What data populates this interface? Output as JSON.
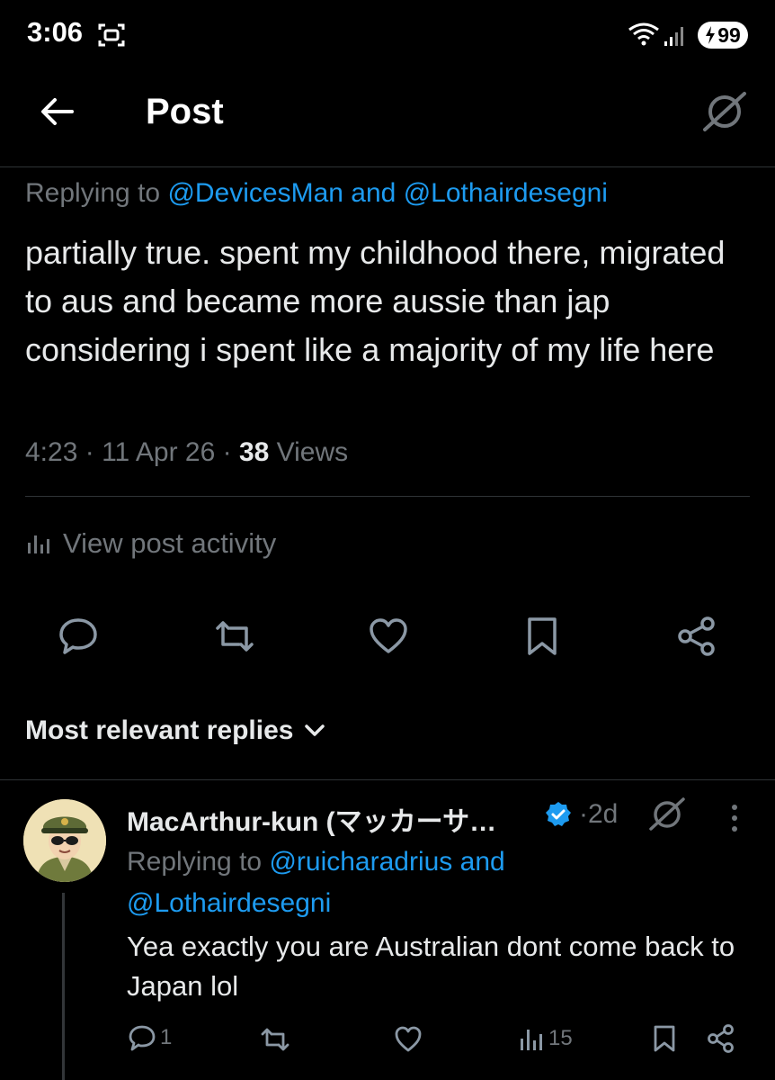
{
  "status_bar": {
    "time": "3:06",
    "battery": "99"
  },
  "header": {
    "title": "Post"
  },
  "post": {
    "replying_prefix": "Replying to",
    "replying_user1": "@DevicesMan",
    "replying_and": "and",
    "replying_user2": "@Lothairdesegni",
    "text": "partially true. spent my childhood there, migrated to aus and became more aussie than jap considering i spent like a majority of my life here",
    "time": "4:23",
    "date": "11 Apr 26",
    "views_count": "38",
    "views_label": "Views",
    "activity_label": "View post activity"
  },
  "replies_sort": {
    "label": "Most relevant replies"
  },
  "reply": {
    "author": "MacArthur-kun (マッカーサ…",
    "age": "2d",
    "replying_prefix": "Replying to",
    "replying_user1": "@ruicharadrius",
    "replying_and": "and",
    "replying_user2": "@Lothairdesegni",
    "text": "Yea exactly you are Australian dont come back to Japan lol",
    "reply_count": "1",
    "views_count": "15"
  },
  "colors": {
    "background": "#000000",
    "text": "#e7e9ea",
    "muted": "#71767b",
    "accent": "#1d9bf0",
    "divider": "#2f3336"
  },
  "icons": {
    "back": "arrow-left-icon",
    "grok": "grok-icon",
    "reply": "speech-bubble-icon",
    "repost": "repost-icon",
    "like": "heart-icon",
    "bookmark": "bookmark-icon",
    "share": "share-icon",
    "analytics": "bar-chart-icon",
    "verified": "verified-badge-icon",
    "more": "more-vertical-icon",
    "chevron": "chevron-down-icon"
  }
}
